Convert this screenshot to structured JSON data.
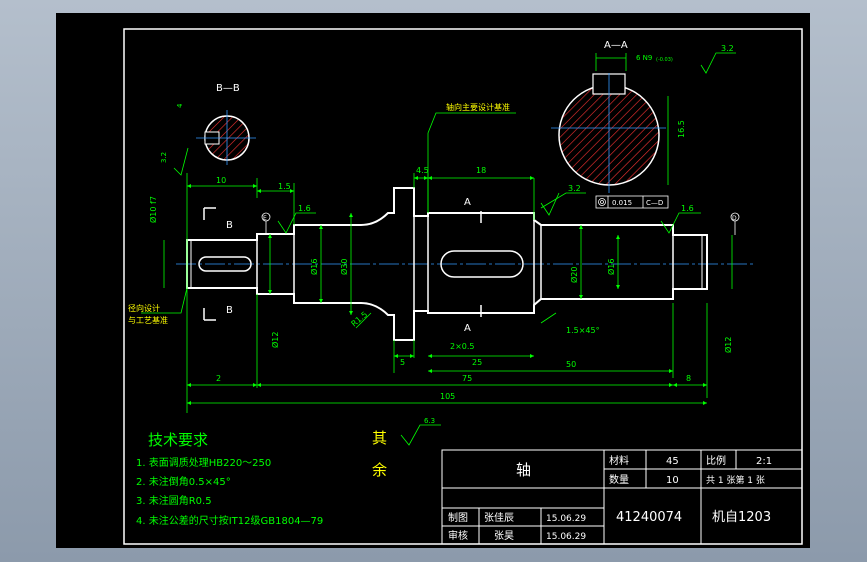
{
  "colors": {
    "background": "#000000",
    "outline": "#ffffff",
    "dimension": "#00ff00",
    "centerline": "#3399ff",
    "hatch": "#ff3333",
    "note": "#ffff00"
  },
  "section_labels": {
    "aa": "A—A",
    "bb": "B—B",
    "a_top": "A",
    "a_bottom": "A",
    "b_top": "B",
    "b_bottom": "B"
  },
  "annotations": {
    "axial_datum": "轴向主要设计基准",
    "radial_datum_line1": "径向设计",
    "radial_datum_line2": "与工艺基准"
  },
  "dimensions": {
    "d_6": "6 N9",
    "d_6_tol": "(-0.03)",
    "d_16_5": "16.5",
    "d_4": "4",
    "d_10": "10",
    "d_1_5": "1.5",
    "d_4_5": "4.5",
    "d_18": "18",
    "d_5": "5",
    "d_8x0_5": "2×0.5",
    "d_25": "25",
    "d_1_5x45": "1.5×45°",
    "d_50": "50",
    "d_2": "2",
    "d_75": "75",
    "d_8": "8",
    "d_105": "105",
    "dia_10_left": "Ø10 f7",
    "dia_12_left": "Ø12",
    "dia_16_left": "Ø16",
    "dia_30": "Ø30",
    "dia_20": "Ø20",
    "dia_16_right": "Ø16",
    "dia_12_right": "Ø12",
    "fillet": "R1.5",
    "rough_1_6_left": "1.6",
    "rough_1_6_right": "1.6",
    "rough_3_2_a": "3.2",
    "rough_3_2_b": "3.2",
    "rough_3_2_c": "3.2",
    "datum_e": "E",
    "datum_d": "D",
    "tol_value": "0.015",
    "tol_datum": "C—D"
  },
  "tech_requirements": {
    "title": "技术要求",
    "items": [
      "1. 表面调质处理HB220～250",
      "2. 未注倒角0.5×45°",
      "3. 未注圆角R0.5",
      "4. 未注公差的尺寸按IT12级GB1804—79"
    ]
  },
  "remaining_roughness": {
    "label1": "其",
    "label2": "余",
    "value": "6.3"
  },
  "title_block": {
    "part_name": "轴",
    "material_label": "材料",
    "material_value": "45",
    "scale_label": "比例",
    "scale_value": "2:1",
    "quantity_label": "数量",
    "quantity_value": "10",
    "sheets_text": "共 1 张第 1 张",
    "drawn_label": "制图",
    "drawn_name": "张佳辰",
    "drawn_date": "15.06.29",
    "checked_label": "审核",
    "checked_name": "张昊",
    "checked_date": "15.06.29",
    "drawing_number": "41240074",
    "class_name": "机自1203"
  }
}
